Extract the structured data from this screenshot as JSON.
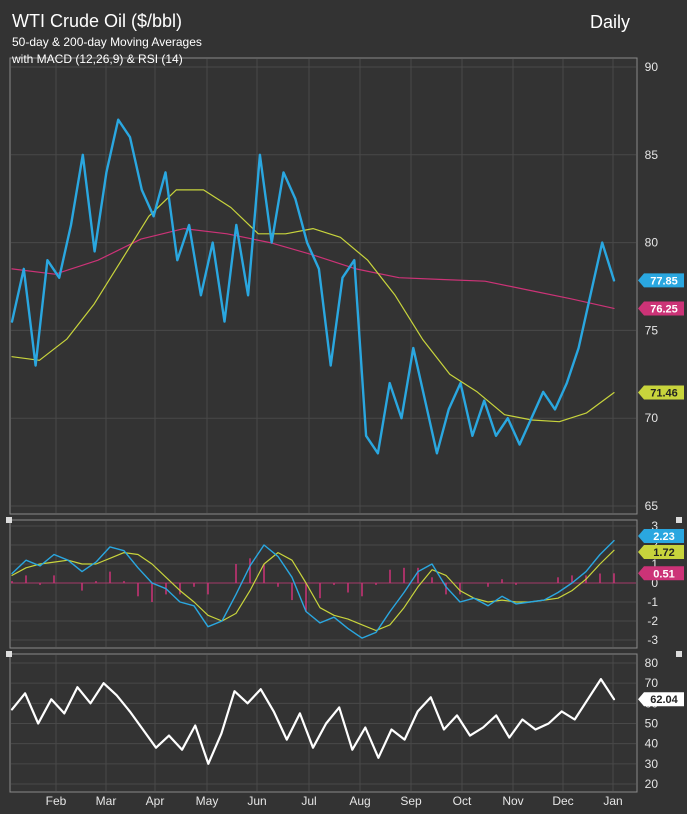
{
  "chart_data": [
    {
      "type": "line",
      "title": "WTI Crude Oil ($/bbl)",
      "subtitle_lines": [
        "50-day & 200-day Moving Averages",
        "with MACD (12,26,9) & RSI (14)"
      ],
      "period": "Daily",
      "x": [
        "Feb",
        "Mar",
        "Apr",
        "May",
        "Jun",
        "Jul",
        "Aug",
        "Sep",
        "Oct",
        "Nov",
        "Dec",
        "Jan"
      ],
      "ylim": [
        65,
        90
      ],
      "yticks": [
        "65",
        "70",
        "75",
        "80",
        "85",
        "90"
      ],
      "grid": true,
      "series": [
        {
          "key": "price",
          "color": "#2aa7e0",
          "last_value": "77.85",
          "values": [
            75.5,
            78.5,
            73.0,
            79.0,
            78.0,
            81.0,
            85.0,
            79.5,
            84.0,
            87.0,
            86.0,
            83.0,
            81.5,
            84.0,
            79.0,
            81.0,
            77.0,
            80.0,
            75.5,
            81.0,
            77.0,
            85.0,
            80.0,
            84.0,
            82.5,
            80.0,
            78.5,
            73.0,
            78.0,
            79.0,
            69.0,
            68.0,
            72.0,
            70.0,
            74.0,
            71.0,
            68.0,
            70.5,
            72.0,
            69.0,
            71.0,
            69.0,
            70.0,
            68.5,
            70.0,
            71.5,
            70.5,
            72.0,
            74.0,
            77.0,
            80.0,
            77.85
          ]
        },
        {
          "key": "sma50",
          "color": "#c8d43c",
          "last_value": "71.46",
          "values": [
            73.5,
            73.3,
            74.5,
            76.5,
            79.0,
            81.5,
            83.0,
            83.0,
            82.0,
            80.5,
            80.5,
            80.8,
            80.3,
            79.0,
            77.0,
            74.5,
            72.5,
            71.5,
            70.2,
            69.9,
            69.8,
            70.3,
            71.46
          ]
        },
        {
          "key": "sma200",
          "color": "#cc3377",
          "last_value": "76.25",
          "values": [
            78.5,
            78.2,
            79.0,
            80.2,
            80.8,
            80.5,
            80.0,
            79.3,
            78.5,
            78.0,
            77.9,
            77.8,
            77.3,
            76.8,
            76.25
          ]
        }
      ]
    },
    {
      "type": "line",
      "title": "",
      "ylim": [
        -3,
        3
      ],
      "yticks": [
        "-3",
        "-2",
        "-1",
        "0",
        "1",
        "2",
        "3"
      ],
      "series": [
        {
          "key": "macd",
          "color": "#2aa7e0",
          "last_value": "2.23",
          "values": [
            0.5,
            1.2,
            0.9,
            1.5,
            1.2,
            0.6,
            1.1,
            1.9,
            1.7,
            0.8,
            0.0,
            -0.3,
            -1.0,
            -1.2,
            -2.3,
            -2.0,
            -0.6,
            0.9,
            2.0,
            1.4,
            0.3,
            -1.5,
            -2.1,
            -1.8,
            -2.4,
            -2.9,
            -2.6,
            -1.5,
            -0.5,
            0.6,
            1.0,
            -0.2,
            -1.0,
            -0.8,
            -1.2,
            -0.7,
            -1.1,
            -1.0,
            -0.9,
            -0.5,
            0.0,
            0.6,
            1.5,
            2.23
          ]
        },
        {
          "key": "signal",
          "color": "#c8d43c",
          "last_value": "1.72",
          "values": [
            0.4,
            0.8,
            1.0,
            1.1,
            1.2,
            1.0,
            1.0,
            1.3,
            1.6,
            1.5,
            1.0,
            0.3,
            -0.4,
            -1.0,
            -1.7,
            -2.0,
            -1.6,
            -0.4,
            1.0,
            1.6,
            1.2,
            0.0,
            -1.3,
            -1.7,
            -1.9,
            -2.2,
            -2.5,
            -2.2,
            -1.3,
            -0.2,
            0.7,
            0.4,
            -0.4,
            -0.8,
            -1.0,
            -0.9,
            -1.0,
            -1.0,
            -0.9,
            -0.8,
            -0.4,
            0.2,
            1.0,
            1.72
          ]
        },
        {
          "key": "histogram",
          "color": "#cc3377",
          "last_value": "0.51",
          "values": [
            0.1,
            0.4,
            -0.1,
            0.4,
            0.0,
            -0.4,
            0.1,
            0.6,
            0.1,
            -0.7,
            -1.0,
            -0.6,
            -0.6,
            -0.2,
            -0.6,
            0.0,
            1.0,
            1.3,
            1.0,
            -0.2,
            -0.9,
            -1.5,
            -0.8,
            -0.1,
            -0.5,
            -0.7,
            -0.1,
            0.7,
            0.8,
            0.8,
            0.3,
            -0.6,
            -0.6,
            0.0,
            -0.2,
            0.2,
            -0.1,
            0.0,
            0.0,
            0.3,
            0.4,
            0.4,
            0.5,
            0.51
          ]
        }
      ]
    },
    {
      "type": "line",
      "title": "",
      "ylim": [
        20,
        80
      ],
      "yticks": [
        "20",
        "30",
        "40",
        "50",
        "60",
        "70",
        "80"
      ],
      "series": [
        {
          "key": "rsi",
          "color": "#ffffff",
          "last_value": "62.04",
          "values": [
            57,
            65,
            50,
            62,
            55,
            68,
            60,
            70,
            64,
            56,
            47,
            38,
            44,
            37,
            49,
            30,
            45,
            66,
            60,
            67,
            56,
            42,
            55,
            38,
            50,
            58,
            37,
            48,
            33,
            47,
            42,
            56,
            63,
            47,
            54,
            44,
            48,
            54,
            43,
            52,
            47,
            50,
            56,
            52,
            62,
            72,
            62.04
          ]
        }
      ]
    }
  ]
}
